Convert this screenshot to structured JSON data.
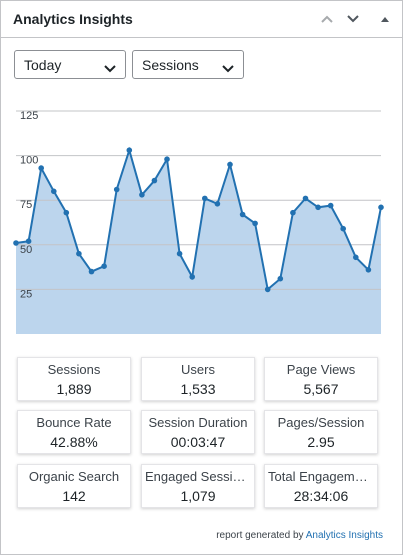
{
  "widget": {
    "title": "Analytics Insights"
  },
  "icons": {
    "move_up": "chevron-up-icon",
    "move_down": "chevron-down-icon",
    "toggle": "triangle-up-icon"
  },
  "filters": {
    "period": "Today",
    "metric": "Sessions"
  },
  "colors": {
    "line": "#2271b1",
    "area": "#b8d3ec",
    "grid": "#c3c4c7",
    "link": "#2271b1"
  },
  "chart_data": {
    "type": "area",
    "y_ticks": [
      "125",
      "100",
      "75",
      "50",
      "25"
    ],
    "ylim": [
      0,
      125
    ],
    "grid": true,
    "values": [
      51,
      52,
      93,
      80,
      68,
      45,
      35,
      38,
      81,
      103,
      78,
      86,
      98,
      45,
      32,
      76,
      73,
      95,
      67,
      62,
      25,
      31,
      68,
      76,
      71,
      72,
      59,
      43,
      36,
      71
    ]
  },
  "stats": [
    {
      "label": "Sessions",
      "value": "1,889"
    },
    {
      "label": "Users",
      "value": "1,533"
    },
    {
      "label": "Page Views",
      "value": "5,567"
    },
    {
      "label": "Bounce Rate",
      "value": "42.88%"
    },
    {
      "label": "Session Duration",
      "value": "00:03:47"
    },
    {
      "label": "Pages/Session",
      "value": "2.95"
    },
    {
      "label": "Organic Search",
      "value": "142"
    },
    {
      "label": "Engaged Sessions",
      "value": "1,079"
    },
    {
      "label": "Total Engagement Time",
      "value": "28:34:06"
    }
  ],
  "footer": {
    "text": "report generated by",
    "link": "Analytics Insights"
  }
}
